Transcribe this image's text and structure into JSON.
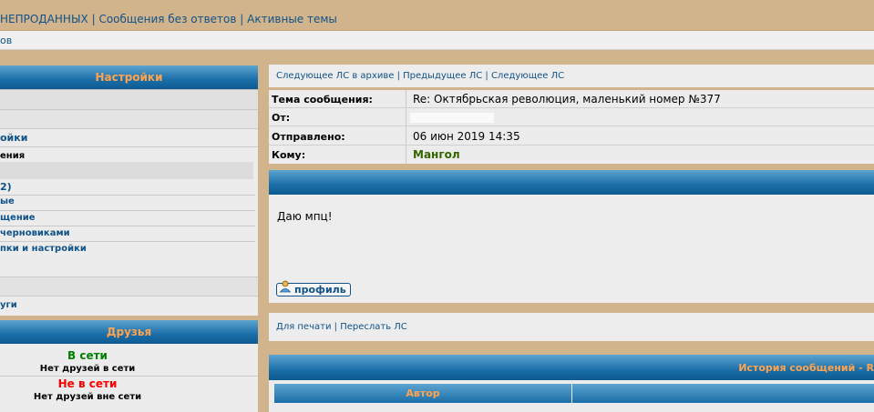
{
  "topnav": {
    "unsold": "НЕПРОДАННЫХ",
    "sep1": "|",
    "unanswered": "Сообщения без ответов",
    "sep2": "|",
    "active": "Активные темы"
  },
  "breadcrumb": "ов",
  "settings_panel": {
    "title": "Настройки",
    "items": [
      "ойки",
      "ения",
      "2)",
      "ые",
      "щение",
      "черновиками",
      "пки и настройки",
      "уги"
    ]
  },
  "friends_panel": {
    "title": "Друзья",
    "online_label": "В сети",
    "online_none": "Нет друзей в сети",
    "offline_label": "Не в сети",
    "offline_none": "Нет друзей вне сети"
  },
  "message_nav": {
    "next_archive": "Следующее ЛС в архиве",
    "sep1": "|",
    "previous": "Предыдущее ЛС",
    "sep2": "|",
    "next": "Следующее ЛС"
  },
  "message_info": {
    "subject_label": "Тема сообщения:",
    "subject_value": "Re: Октябрьская революция, маленький номер №377",
    "from_label": "От:",
    "from_value": "",
    "sent_label": "Отправлено:",
    "sent_value": "06 июн 2019 14:35",
    "to_label": "Кому:",
    "to_value": "Мангол"
  },
  "message_body": {
    "text": "Даю мпц!",
    "profile_button": "профиль"
  },
  "bottom_nav": {
    "print": "Для печати",
    "sep": "|",
    "forward": "Переслать ЛС"
  },
  "history": {
    "title": "История сообщений - R",
    "author_col": "Автор"
  },
  "colors": {
    "page_bg": "#d2b48c",
    "link": "#105289",
    "header_text": "#ffa34f",
    "online": "#008000",
    "offline": "#ff0000",
    "recipient": "#008000"
  }
}
